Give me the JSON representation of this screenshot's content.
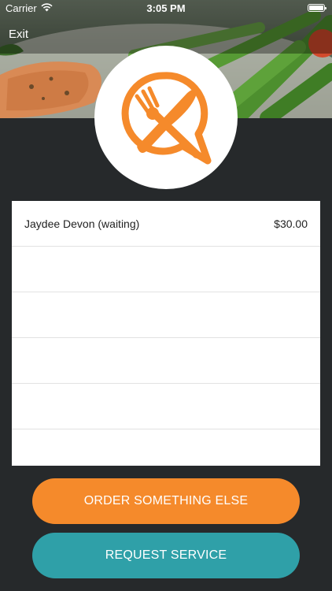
{
  "status_bar": {
    "carrier": "Carrier",
    "time": "3:05 PM"
  },
  "nav": {
    "exit_label": "Exit"
  },
  "logo": {
    "icon": "restaurant-chat-logo",
    "color": "#f58a2b"
  },
  "orders": {
    "rows": [
      {
        "name": "Jaydee Devon (waiting)",
        "price": "$30.00"
      },
      {
        "name": "",
        "price": ""
      },
      {
        "name": "",
        "price": ""
      },
      {
        "name": "",
        "price": ""
      },
      {
        "name": "",
        "price": ""
      },
      {
        "name": "",
        "price": ""
      }
    ]
  },
  "actions": {
    "order_label": "ORDER SOMETHING ELSE",
    "service_label": "REQUEST SERVICE"
  },
  "colors": {
    "accent": "#f58a2b",
    "secondary": "#2fa0a8",
    "background": "#26292b"
  }
}
